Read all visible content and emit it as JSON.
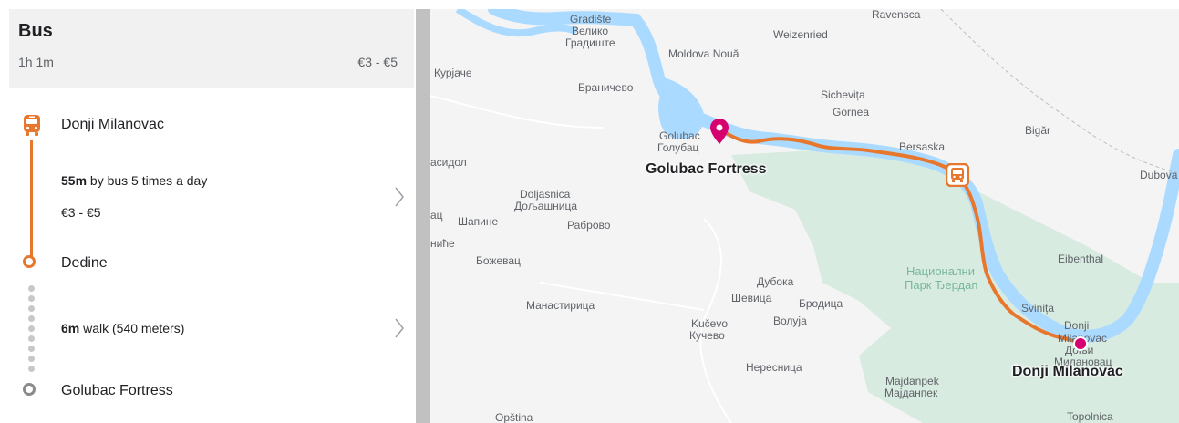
{
  "panel": {
    "title": "Bus",
    "duration": "1h 1m",
    "price": "€3 - €5",
    "stops": [
      "Donji Milanovac",
      "Dedine",
      "Golubac Fortress"
    ],
    "segments": [
      {
        "bold": "55m",
        "text": " by bus 5 times a day",
        "price": "€3 - €5"
      },
      {
        "bold": "6m",
        "text": " walk (540 meters)"
      }
    ],
    "icons": [
      "bus-icon",
      "chevron-right-icon",
      "circle-stop-icon"
    ],
    "colors": {
      "route": "#e8772e",
      "pin": "#d6006f",
      "water": "#aadaff",
      "park": "#cfe8d9"
    }
  },
  "map": {
    "labels": [
      "Gradište",
      "Велико",
      "Градиште",
      "Ravensca",
      "Weizenried",
      "Moldova Nouă",
      "Курјаче",
      "Браничево",
      "Sichevița",
      "Gornea",
      "Bigăr",
      "Golubac",
      "Голубац",
      "Bersaska",
      "асидол",
      "Dubova",
      "Doljasnica",
      "Дољашница",
      "ац",
      "Шапине",
      "Раброво",
      "ниће",
      "Божевац",
      "Eibenthal",
      "Дубока",
      "Шевица",
      "Бродица",
      "Манастирица",
      "Волуја",
      "Svinița",
      "Kučevo",
      "Кучево",
      "Donji",
      "Milanovac",
      "Доњи",
      "Милановац",
      "Нересница",
      "Majdanpek",
      "Мајданпек",
      "Opština",
      "Topolnica"
    ],
    "park_label": [
      "Национални",
      "Парк Ђердап"
    ],
    "place_golubac": "Golubac Fortress",
    "place_donji": "Donji Milanovac"
  }
}
